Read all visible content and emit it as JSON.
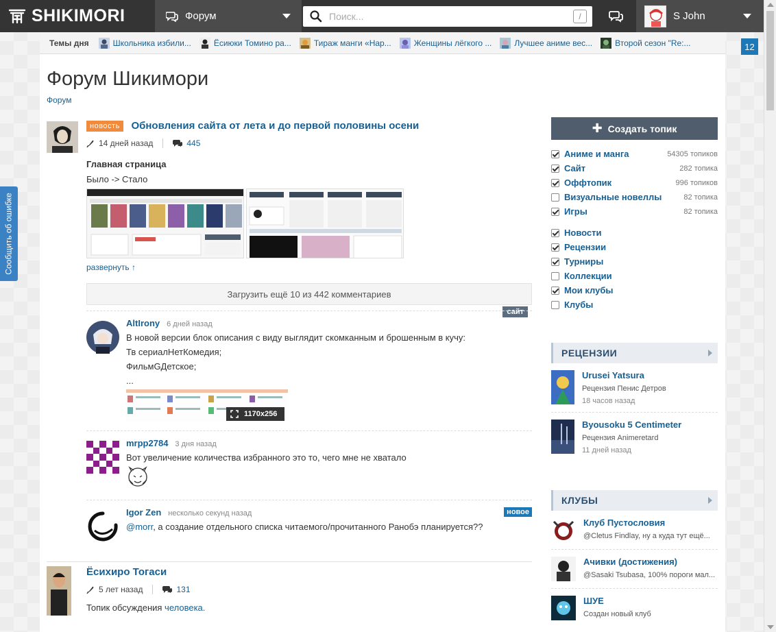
{
  "header": {
    "logo_text": "SHIKIMORI",
    "section_label": "Форум",
    "search_placeholder": "Поиск...",
    "search_shortcut": "/",
    "user_name": "S John"
  },
  "notification_count": "12",
  "feedback_label": "Сообщить об ошибке",
  "topics_of_day": {
    "label": "Темы дня",
    "items": [
      "Школьника избили...",
      "Ёсиюки Томино ра...",
      "Тираж манги «Нар...",
      "Женщины лёгкого ...",
      "Лучшее аниме вес...",
      "Второй сезон \"Re:..."
    ]
  },
  "page": {
    "title": "Форум Шикимори",
    "breadcrumb": "Форум"
  },
  "main_topic": {
    "badge": "новость",
    "title": "Обновления сайта от лета и до первой половины осени",
    "time": "14 дней назад",
    "comments": "445",
    "section_heading": "Главная страница",
    "text": "Было -> Стало",
    "expand_label": "развернуть ↑",
    "tag": "сайт",
    "load_more": "Загрузить ещё 10 из 442 комментариев"
  },
  "comments": [
    {
      "author": "AltIrony",
      "time": "6 дней назад",
      "lines": [
        "В новой версии блок описания с виду выглядит скомканным и брошенным в кучу:",
        "Тв сериалНетКомедия;",
        "ФильмGДетское;",
        "..."
      ],
      "image_size": "1170x256"
    },
    {
      "author": "mrpp2784",
      "time": "3 дня назад",
      "lines": [
        "Вот увеличение количества избранного это то, чего мне не хватало"
      ]
    },
    {
      "author": "Igor Zen",
      "time": "несколько секунд назад",
      "new_badge": "новое",
      "mention": "@morr",
      "text": ", а создание отдельного списка читаемого/прочитанного Ранобэ планируется??"
    }
  ],
  "second_topic": {
    "title": "Ёсихиро Тогаси",
    "time": "5 лет назад",
    "comments": "131",
    "text_prefix": "Топик обсуждения ",
    "text_link": "человека."
  },
  "sidebar": {
    "create_button": "Создать топик",
    "categories": [
      {
        "name": "Аниме и манга",
        "count": "54305 топиков",
        "checked": true
      },
      {
        "name": "Сайт",
        "count": "282 топика",
        "checked": true
      },
      {
        "name": "Оффтопик",
        "count": "996 топиков",
        "checked": true
      },
      {
        "name": "Визуальные новеллы",
        "count": "82 топика",
        "checked": false
      },
      {
        "name": "Игры",
        "count": "82 топика",
        "checked": true
      }
    ],
    "filters": [
      {
        "name": "Новости",
        "checked": true
      },
      {
        "name": "Рецензии",
        "checked": true
      },
      {
        "name": "Турниры",
        "checked": true
      },
      {
        "name": "Коллекции",
        "checked": false
      },
      {
        "name": "Мои клубы",
        "checked": true
      },
      {
        "name": "Клубы",
        "checked": false
      }
    ],
    "reviews": {
      "heading": "РЕЦЕНЗИИ",
      "items": [
        {
          "title": "Urusei Yatsura",
          "sub": "Рецензия Пенис Детров",
          "date": "18 часов назад"
        },
        {
          "title": "Byousoku 5 Centimeter",
          "sub": "Рецензия Animeretard",
          "date": "11 дней назад"
        }
      ]
    },
    "clubs": {
      "heading": "КЛУБЫ",
      "items": [
        {
          "title": "Клуб Пустословия",
          "sub": "@Cletus Findlay, ну а куда тут ещё..."
        },
        {
          "title": "Ачивки (достижения)",
          "sub": "@Sasaki Tsubasa, 100% пороги мал..."
        },
        {
          "title": "ШУЕ",
          "sub": "Создан новый клуб"
        }
      ]
    }
  },
  "colors": {
    "header_bg": "#343434",
    "link": "#176093",
    "news_badge": "#f08b3d",
    "new_badge": "#1d78b8",
    "create_button": "#4f5d6c"
  }
}
